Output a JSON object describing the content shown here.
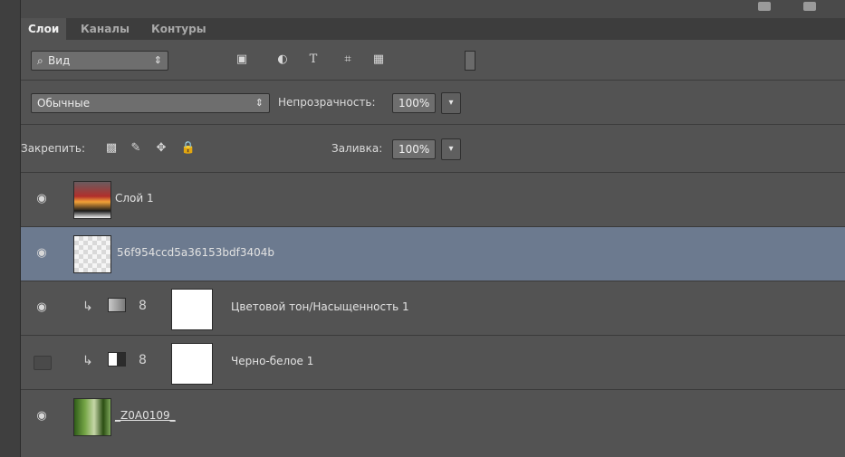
{
  "tabs": [
    "Слои",
    "Каналы",
    "Контуры"
  ],
  "filter": {
    "label": "Вид"
  },
  "blend": {
    "mode": "Обычные",
    "opacity_label": "Непрозрачность:",
    "opacity_value": "100%"
  },
  "lock": {
    "label": "Закрепить:",
    "fill_label": "Заливка:",
    "fill_value": "100%"
  },
  "layers": [
    {
      "name": "Слой 1",
      "visible": true
    },
    {
      "name": "56f954ccd5a36153bdf3404b",
      "visible": true,
      "selected": true
    },
    {
      "name": "Цветовой тон/Насыщенность 1",
      "visible": true
    },
    {
      "name": "Черно-белое 1",
      "visible": false
    },
    {
      "name": "_Z0A0109_",
      "visible": true
    }
  ],
  "colors": {
    "panel": "#535353",
    "selected": "#6c7a8f"
  }
}
